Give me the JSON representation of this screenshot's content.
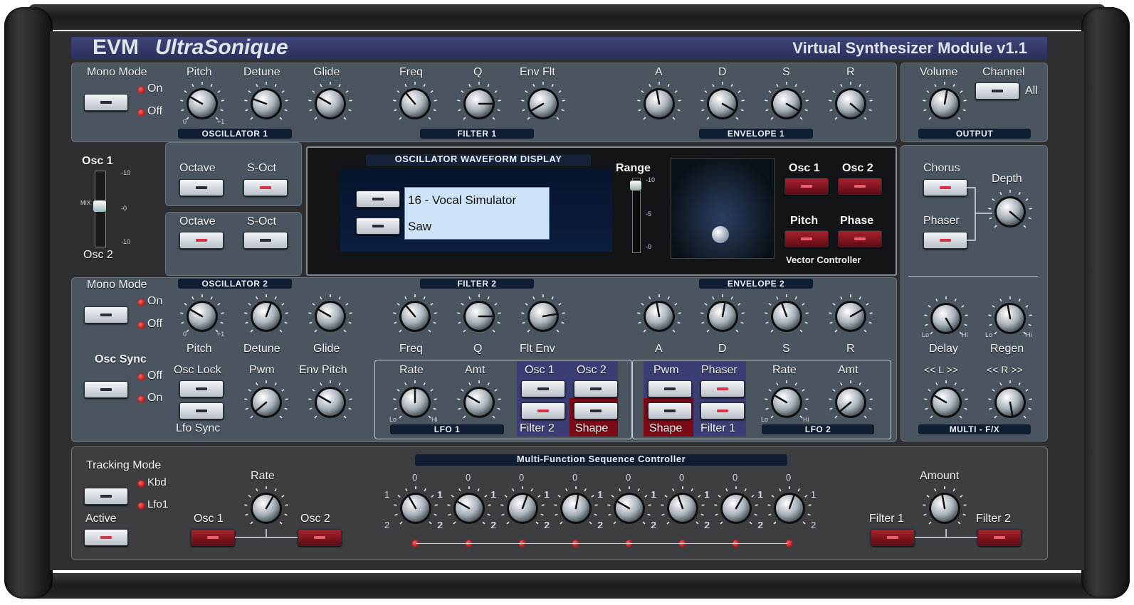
{
  "header": {
    "brand": "EVM",
    "product": "UltraSonique",
    "subtitle": "Virtual Synthesizer Module v1.1"
  },
  "osc1": {
    "mono_mode": "Mono Mode",
    "on": "On",
    "off": "Off",
    "pitch": "Pitch",
    "detune": "Detune",
    "glide": "Glide",
    "tag": "OSCILLATOR 1",
    "pitch_min": "0",
    "pitch_max": "+1"
  },
  "filter1": {
    "freq": "Freq",
    "q": "Q",
    "env_flt": "Env Flt",
    "tag": "FILTER 1"
  },
  "env1": {
    "a": "A",
    "d": "D",
    "s": "S",
    "r": "R",
    "tag": "ENVELOPE 1"
  },
  "output": {
    "volume": "Volume",
    "channel": "Channel",
    "all": "All",
    "tag": "OUTPUT"
  },
  "mix": {
    "osc1": "Osc 1",
    "osc2": "Osc 2",
    "mix": "MIX",
    "ticks": [
      "-10",
      "-0",
      "-10"
    ]
  },
  "octave_rows": [
    {
      "octave": "Octave",
      "soct": "S-Oct"
    },
    {
      "octave": "Octave",
      "soct": "S-Oct"
    }
  ],
  "display": {
    "title": "OSCILLATOR WAVEFORM DISPLAY",
    "wave1": "16 - Vocal Simulator",
    "wave2": "Saw",
    "range": "Range",
    "range_ticks": [
      "-10",
      "-5",
      "-0"
    ]
  },
  "vector": {
    "osc1": "Osc 1",
    "osc2": "Osc 2",
    "pitch": "Pitch",
    "phase": "Phase",
    "label": "Vector Controller"
  },
  "fx": {
    "chorus": "Chorus",
    "depth": "Depth",
    "phaser": "Phaser",
    "delay": "Delay",
    "regen": "Regen",
    "l": "<< L >>",
    "r": "<< R >>",
    "lo": "Lo",
    "hi": "Hi",
    "tag": "MULTI - F/X"
  },
  "osc2": {
    "tag": "OSCILLATOR 2",
    "mono_mode": "Mono Mode",
    "on": "On",
    "off": "Off",
    "pitch": "Pitch",
    "detune": "Detune",
    "glide": "Glide",
    "osc_sync": "Osc Sync",
    "sync_off": "Off",
    "sync_on": "On",
    "osc_lock": "Osc Lock",
    "lfo_sync": "Lfo Sync",
    "pwm": "Pwm",
    "env_pitch": "Env Pitch"
  },
  "filter2": {
    "tag": "FILTER 2",
    "freq": "Freq",
    "q": "Q",
    "flt_env": "Flt Env"
  },
  "env2": {
    "tag": "ENVELOPE 2",
    "a": "A",
    "d": "D",
    "s": "S",
    "r": "R"
  },
  "lfo1": {
    "rate": "Rate",
    "amt": "Amt",
    "osc1": "Osc 1",
    "osc2": "Osc 2",
    "filter2": "Filter 2",
    "shape": "Shape",
    "tag": "LFO 1",
    "lo": "Lo",
    "hi": "Hi"
  },
  "lfo2": {
    "pwm": "Pwm",
    "phaser": "Phaser",
    "rate": "Rate",
    "amt": "Amt",
    "shape": "Shape",
    "filter1": "Filter 1",
    "tag": "LFO 2",
    "lo": "Lo",
    "hi": "Hi"
  },
  "seq": {
    "tracking_mode": "Tracking Mode",
    "kbd": "Kbd",
    "lfo1": "Lfo1",
    "active": "Active",
    "rate": "Rate",
    "osc1": "Osc 1",
    "osc2": "Osc 2",
    "title": "Multi-Function Sequence Controller",
    "amount": "Amount",
    "filter1": "Filter 1",
    "filter2": "Filter 2",
    "step_top": "0",
    "step_left": "1",
    "step_right": "1",
    "step_bottom": "2"
  },
  "colors": {
    "panel": "#4a5560",
    "tag": "#0f1e33",
    "header": "#2a2f5a",
    "led": "#ff2020",
    "display": "#cde3f7"
  }
}
